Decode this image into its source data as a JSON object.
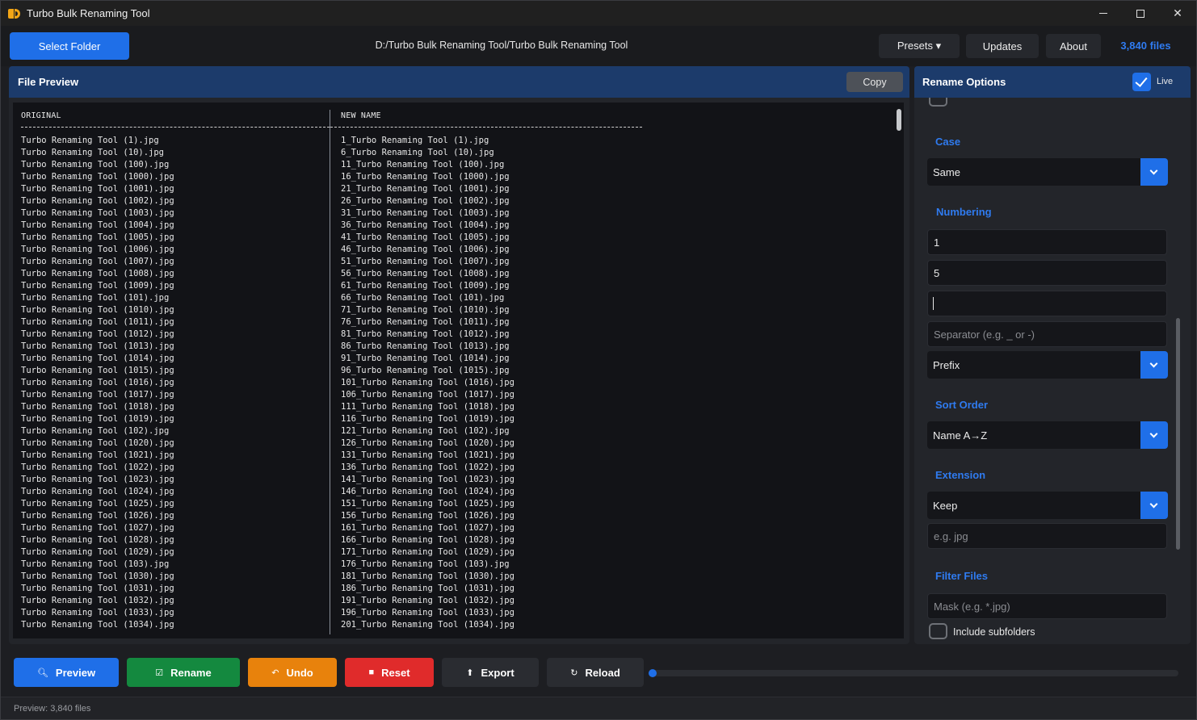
{
  "window": {
    "title": "Turbo Bulk Renaming Tool"
  },
  "toolbar": {
    "select_folder": "Select Folder",
    "path": "D:/Turbo Bulk Renaming Tool/Turbo Bulk Renaming Tool",
    "presets": "Presets ▾",
    "updates": "Updates",
    "about": "About",
    "file_count": "3,840 files"
  },
  "file_preview": {
    "title": "File Preview",
    "copy_label": "Copy",
    "header_original": "ORIGINAL",
    "header_new": "NEW NAME",
    "rows": [
      [
        "Turbo Renaming Tool (1).jpg",
        "1_Turbo Renaming Tool (1).jpg"
      ],
      [
        "Turbo Renaming Tool (10).jpg",
        "6_Turbo Renaming Tool (10).jpg"
      ],
      [
        "Turbo Renaming Tool (100).jpg",
        "11_Turbo Renaming Tool (100).jpg"
      ],
      [
        "Turbo Renaming Tool (1000).jpg",
        "16_Turbo Renaming Tool (1000).jpg"
      ],
      [
        "Turbo Renaming Tool (1001).jpg",
        "21_Turbo Renaming Tool (1001).jpg"
      ],
      [
        "Turbo Renaming Tool (1002).jpg",
        "26_Turbo Renaming Tool (1002).jpg"
      ],
      [
        "Turbo Renaming Tool (1003).jpg",
        "31_Turbo Renaming Tool (1003).jpg"
      ],
      [
        "Turbo Renaming Tool (1004).jpg",
        "36_Turbo Renaming Tool (1004).jpg"
      ],
      [
        "Turbo Renaming Tool (1005).jpg",
        "41_Turbo Renaming Tool (1005).jpg"
      ],
      [
        "Turbo Renaming Tool (1006).jpg",
        "46_Turbo Renaming Tool (1006).jpg"
      ],
      [
        "Turbo Renaming Tool (1007).jpg",
        "51_Turbo Renaming Tool (1007).jpg"
      ],
      [
        "Turbo Renaming Tool (1008).jpg",
        "56_Turbo Renaming Tool (1008).jpg"
      ],
      [
        "Turbo Renaming Tool (1009).jpg",
        "61_Turbo Renaming Tool (1009).jpg"
      ],
      [
        "Turbo Renaming Tool (101).jpg",
        "66_Turbo Renaming Tool (101).jpg"
      ],
      [
        "Turbo Renaming Tool (1010).jpg",
        "71_Turbo Renaming Tool (1010).jpg"
      ],
      [
        "Turbo Renaming Tool (1011).jpg",
        "76_Turbo Renaming Tool (1011).jpg"
      ],
      [
        "Turbo Renaming Tool (1012).jpg",
        "81_Turbo Renaming Tool (1012).jpg"
      ],
      [
        "Turbo Renaming Tool (1013).jpg",
        "86_Turbo Renaming Tool (1013).jpg"
      ],
      [
        "Turbo Renaming Tool (1014).jpg",
        "91_Turbo Renaming Tool (1014).jpg"
      ],
      [
        "Turbo Renaming Tool (1015).jpg",
        "96_Turbo Renaming Tool (1015).jpg"
      ],
      [
        "Turbo Renaming Tool (1016).jpg",
        "101_Turbo Renaming Tool (1016).jpg"
      ],
      [
        "Turbo Renaming Tool (1017).jpg",
        "106_Turbo Renaming Tool (1017).jpg"
      ],
      [
        "Turbo Renaming Tool (1018).jpg",
        "111_Turbo Renaming Tool (1018).jpg"
      ],
      [
        "Turbo Renaming Tool (1019).jpg",
        "116_Turbo Renaming Tool (1019).jpg"
      ],
      [
        "Turbo Renaming Tool (102).jpg",
        "121_Turbo Renaming Tool (102).jpg"
      ],
      [
        "Turbo Renaming Tool (1020).jpg",
        "126_Turbo Renaming Tool (1020).jpg"
      ],
      [
        "Turbo Renaming Tool (1021).jpg",
        "131_Turbo Renaming Tool (1021).jpg"
      ],
      [
        "Turbo Renaming Tool (1022).jpg",
        "136_Turbo Renaming Tool (1022).jpg"
      ],
      [
        "Turbo Renaming Tool (1023).jpg",
        "141_Turbo Renaming Tool (1023).jpg"
      ],
      [
        "Turbo Renaming Tool (1024).jpg",
        "146_Turbo Renaming Tool (1024).jpg"
      ],
      [
        "Turbo Renaming Tool (1025).jpg",
        "151_Turbo Renaming Tool (1025).jpg"
      ],
      [
        "Turbo Renaming Tool (1026).jpg",
        "156_Turbo Renaming Tool (1026).jpg"
      ],
      [
        "Turbo Renaming Tool (1027).jpg",
        "161_Turbo Renaming Tool (1027).jpg"
      ],
      [
        "Turbo Renaming Tool (1028).jpg",
        "166_Turbo Renaming Tool (1028).jpg"
      ],
      [
        "Turbo Renaming Tool (1029).jpg",
        "171_Turbo Renaming Tool (1029).jpg"
      ],
      [
        "Turbo Renaming Tool (103).jpg",
        "176_Turbo Renaming Tool (103).jpg"
      ],
      [
        "Turbo Renaming Tool (1030).jpg",
        "181_Turbo Renaming Tool (1030).jpg"
      ],
      [
        "Turbo Renaming Tool (1031).jpg",
        "186_Turbo Renaming Tool (1031).jpg"
      ],
      [
        "Turbo Renaming Tool (1032).jpg",
        "191_Turbo Renaming Tool (1032).jpg"
      ],
      [
        "Turbo Renaming Tool (1033).jpg",
        "196_Turbo Renaming Tool (1033).jpg"
      ],
      [
        "Turbo Renaming Tool (1034).jpg",
        "201_Turbo Renaming Tool (1034).jpg"
      ]
    ]
  },
  "rename_options": {
    "title": "Rename Options",
    "live_label": "Live",
    "live_checked": true,
    "case": {
      "label": "Case",
      "value": "Same"
    },
    "numbering": {
      "label": "Numbering",
      "start_value": "1",
      "step_value": "5",
      "padding_value": "",
      "separator_placeholder": "Separator (e.g. _ or -)",
      "position_value": "Prefix"
    },
    "sort_order": {
      "label": "Sort Order",
      "value": "Name A→Z"
    },
    "extension": {
      "label": "Extension",
      "value": "Keep",
      "placeholder": "e.g. jpg"
    },
    "filter_files": {
      "label": "Filter Files",
      "mask_placeholder": "Mask (e.g. *.jpg)",
      "include_subfolders": "Include subfolders"
    }
  },
  "actions": {
    "preview": "Preview",
    "rename": "Rename",
    "undo": "Undo",
    "reset": "Reset",
    "export": "Export",
    "reload": "Reload",
    "progress": 0
  },
  "status": {
    "text": "Preview: 3,840 files"
  },
  "colors": {
    "accent": "#1f6fe8",
    "rename": "#14893f",
    "undo": "#e8820c",
    "reset": "#e02b2b",
    "header": "#1c3b6b"
  }
}
